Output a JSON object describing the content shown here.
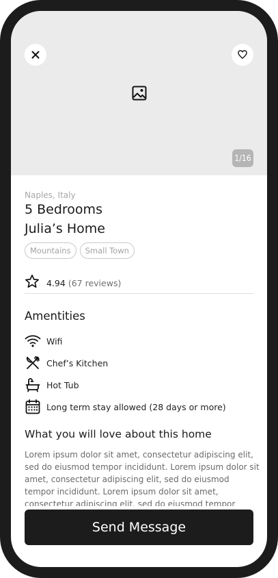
{
  "hero": {
    "close_icon": "close-icon",
    "favorite_icon": "heart-icon",
    "placeholder_icon": "image-icon",
    "photo_counter": "1/16"
  },
  "listing": {
    "location": "Naples, Italy",
    "bedrooms": "5 Bedrooms",
    "name": "Julia’s Home",
    "tags": [
      "Mountains",
      "Small Town"
    ],
    "rating": "4.94",
    "reviews": "(67 reviews)"
  },
  "amenities": {
    "title": "Amentities",
    "items": [
      {
        "icon": "wifi-icon",
        "label": "Wifi"
      },
      {
        "icon": "utensils-icon",
        "label": "Chef’s Kitchen"
      },
      {
        "icon": "bathtub-icon",
        "label": "Hot Tub"
      },
      {
        "icon": "calendar-icon",
        "label": "Long term stay allowed (28 days or more)"
      }
    ]
  },
  "about": {
    "title": "What you will love about this home",
    "text": "Lorem ipsum dolor sit amet, consectetur adipiscing elit, sed do eiusmod tempor incididunt. Lorem ipsum dolor sit amet, consectetur adipiscing elit, sed do eiusmod tempor incididunt. Lorem ipsum dolor sit amet, consectetur adipiscing elit, sed do eiusmod tempor incididunt."
  },
  "cta": {
    "label": "Send Message"
  }
}
